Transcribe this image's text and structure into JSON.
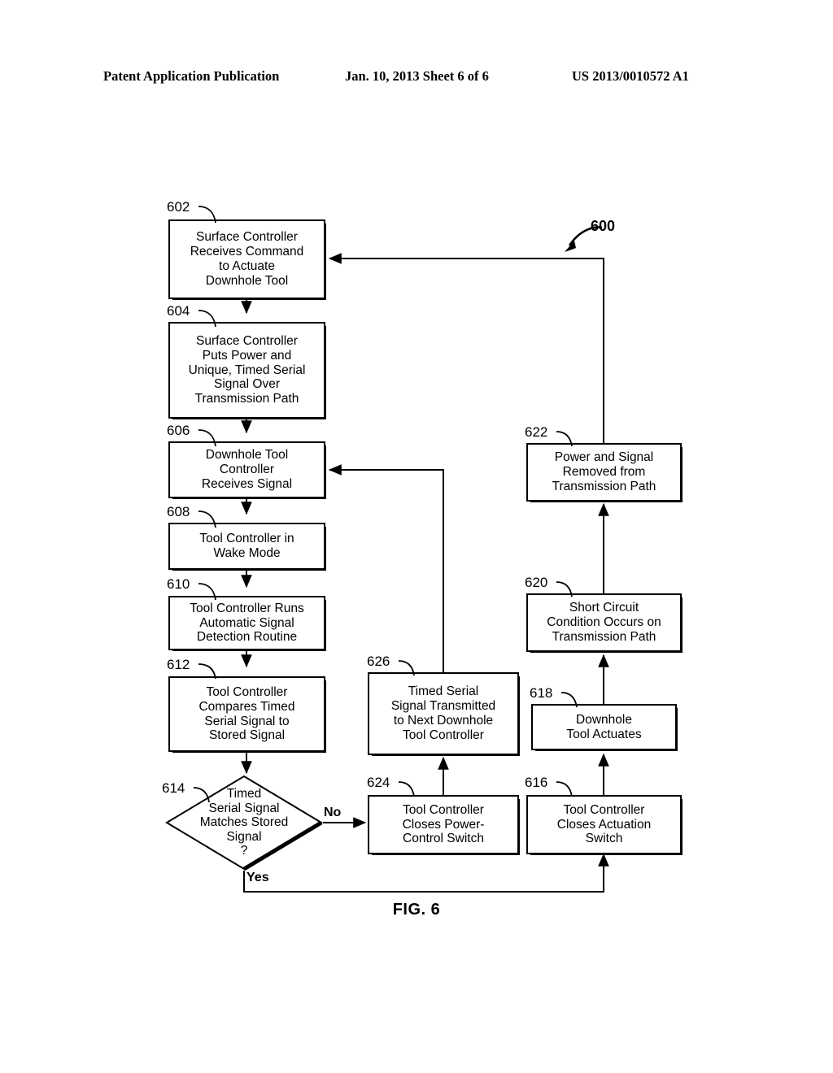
{
  "header": {
    "publication": "Patent Application Publication",
    "date_sheet": "Jan. 10, 2013  Sheet 6 of 6",
    "pub_number": "US 2013/0010572 A1"
  },
  "figure": {
    "caption": "FIG. 6",
    "diagram_numeral": "600"
  },
  "branches": {
    "no_label": "No",
    "yes_label": "Yes"
  },
  "nodes": [
    {
      "id": "602",
      "ref": "602",
      "text": "Surface Controller Receives Command to Actuate Downhole Tool",
      "lines": [
        "Surface Controller",
        "Receives Command",
        "to Actuate",
        "Downhole Tool"
      ]
    },
    {
      "id": "604",
      "ref": "604",
      "text": "Surface Controller Puts Power and Unique, Timed Serial Signal Over Transmission Path",
      "lines": [
        "Surface Controller",
        "Puts Power and",
        "Unique, Timed Serial",
        "Signal Over",
        "Transmission Path"
      ]
    },
    {
      "id": "606",
      "ref": "606",
      "text": "Downhole Tool Controller Receives Signal",
      "lines": [
        "Downhole Tool",
        "Controller",
        "Receives Signal"
      ]
    },
    {
      "id": "608",
      "ref": "608",
      "text": "Tool Controller in Wake Mode",
      "lines": [
        "Tool Controller in",
        "Wake Mode"
      ]
    },
    {
      "id": "610",
      "ref": "610",
      "text": "Tool Controller Runs Automatic Signal Detection Routine",
      "lines": [
        "Tool Controller Runs",
        "Automatic Signal",
        "Detection Routine"
      ]
    },
    {
      "id": "612",
      "ref": "612",
      "text": "Tool Controller Compares Timed Serial Signal to Stored Signal",
      "lines": [
        "Tool Controller",
        "Compares Timed",
        "Serial Signal to",
        "Stored Signal"
      ]
    },
    {
      "id": "614",
      "ref": "614",
      "text": "Timed Serial Signal Matches Stored Signal ?",
      "lines": [
        "Timed",
        "Serial Signal",
        "Matches Stored",
        "Signal",
        "?"
      ]
    },
    {
      "id": "616",
      "ref": "616",
      "text": "Tool Controller Closes Actuation Switch",
      "lines": [
        "Tool Controller",
        "Closes Actuation",
        "Switch"
      ]
    },
    {
      "id": "618",
      "ref": "618",
      "text": "Downhole Tool Actuates",
      "lines": [
        "Downhole",
        "Tool Actuates"
      ]
    },
    {
      "id": "620",
      "ref": "620",
      "text": "Short Circuit Condition Occurs on Transmission Path",
      "lines": [
        "Short Circuit",
        "Condition Occurs on",
        "Transmission Path"
      ]
    },
    {
      "id": "622",
      "ref": "622",
      "text": "Power and Signal Removed from Transmission Path",
      "lines": [
        "Power and Signal",
        "Removed from",
        "Transmission Path"
      ]
    },
    {
      "id": "624",
      "ref": "624",
      "text": "Tool Controller Closes Power-Control Switch",
      "lines": [
        "Tool Controller",
        "Closes Power-",
        "Control Switch"
      ]
    },
    {
      "id": "626",
      "ref": "626",
      "text": "Timed Serial Signal Transmitted to Next Downhole Tool Controller",
      "lines": [
        "Timed Serial",
        "Signal Transmitted",
        "to Next Downhole",
        "Tool Controller"
      ]
    }
  ],
  "colors": {
    "ink": "#000000",
    "paper": "#ffffff"
  }
}
